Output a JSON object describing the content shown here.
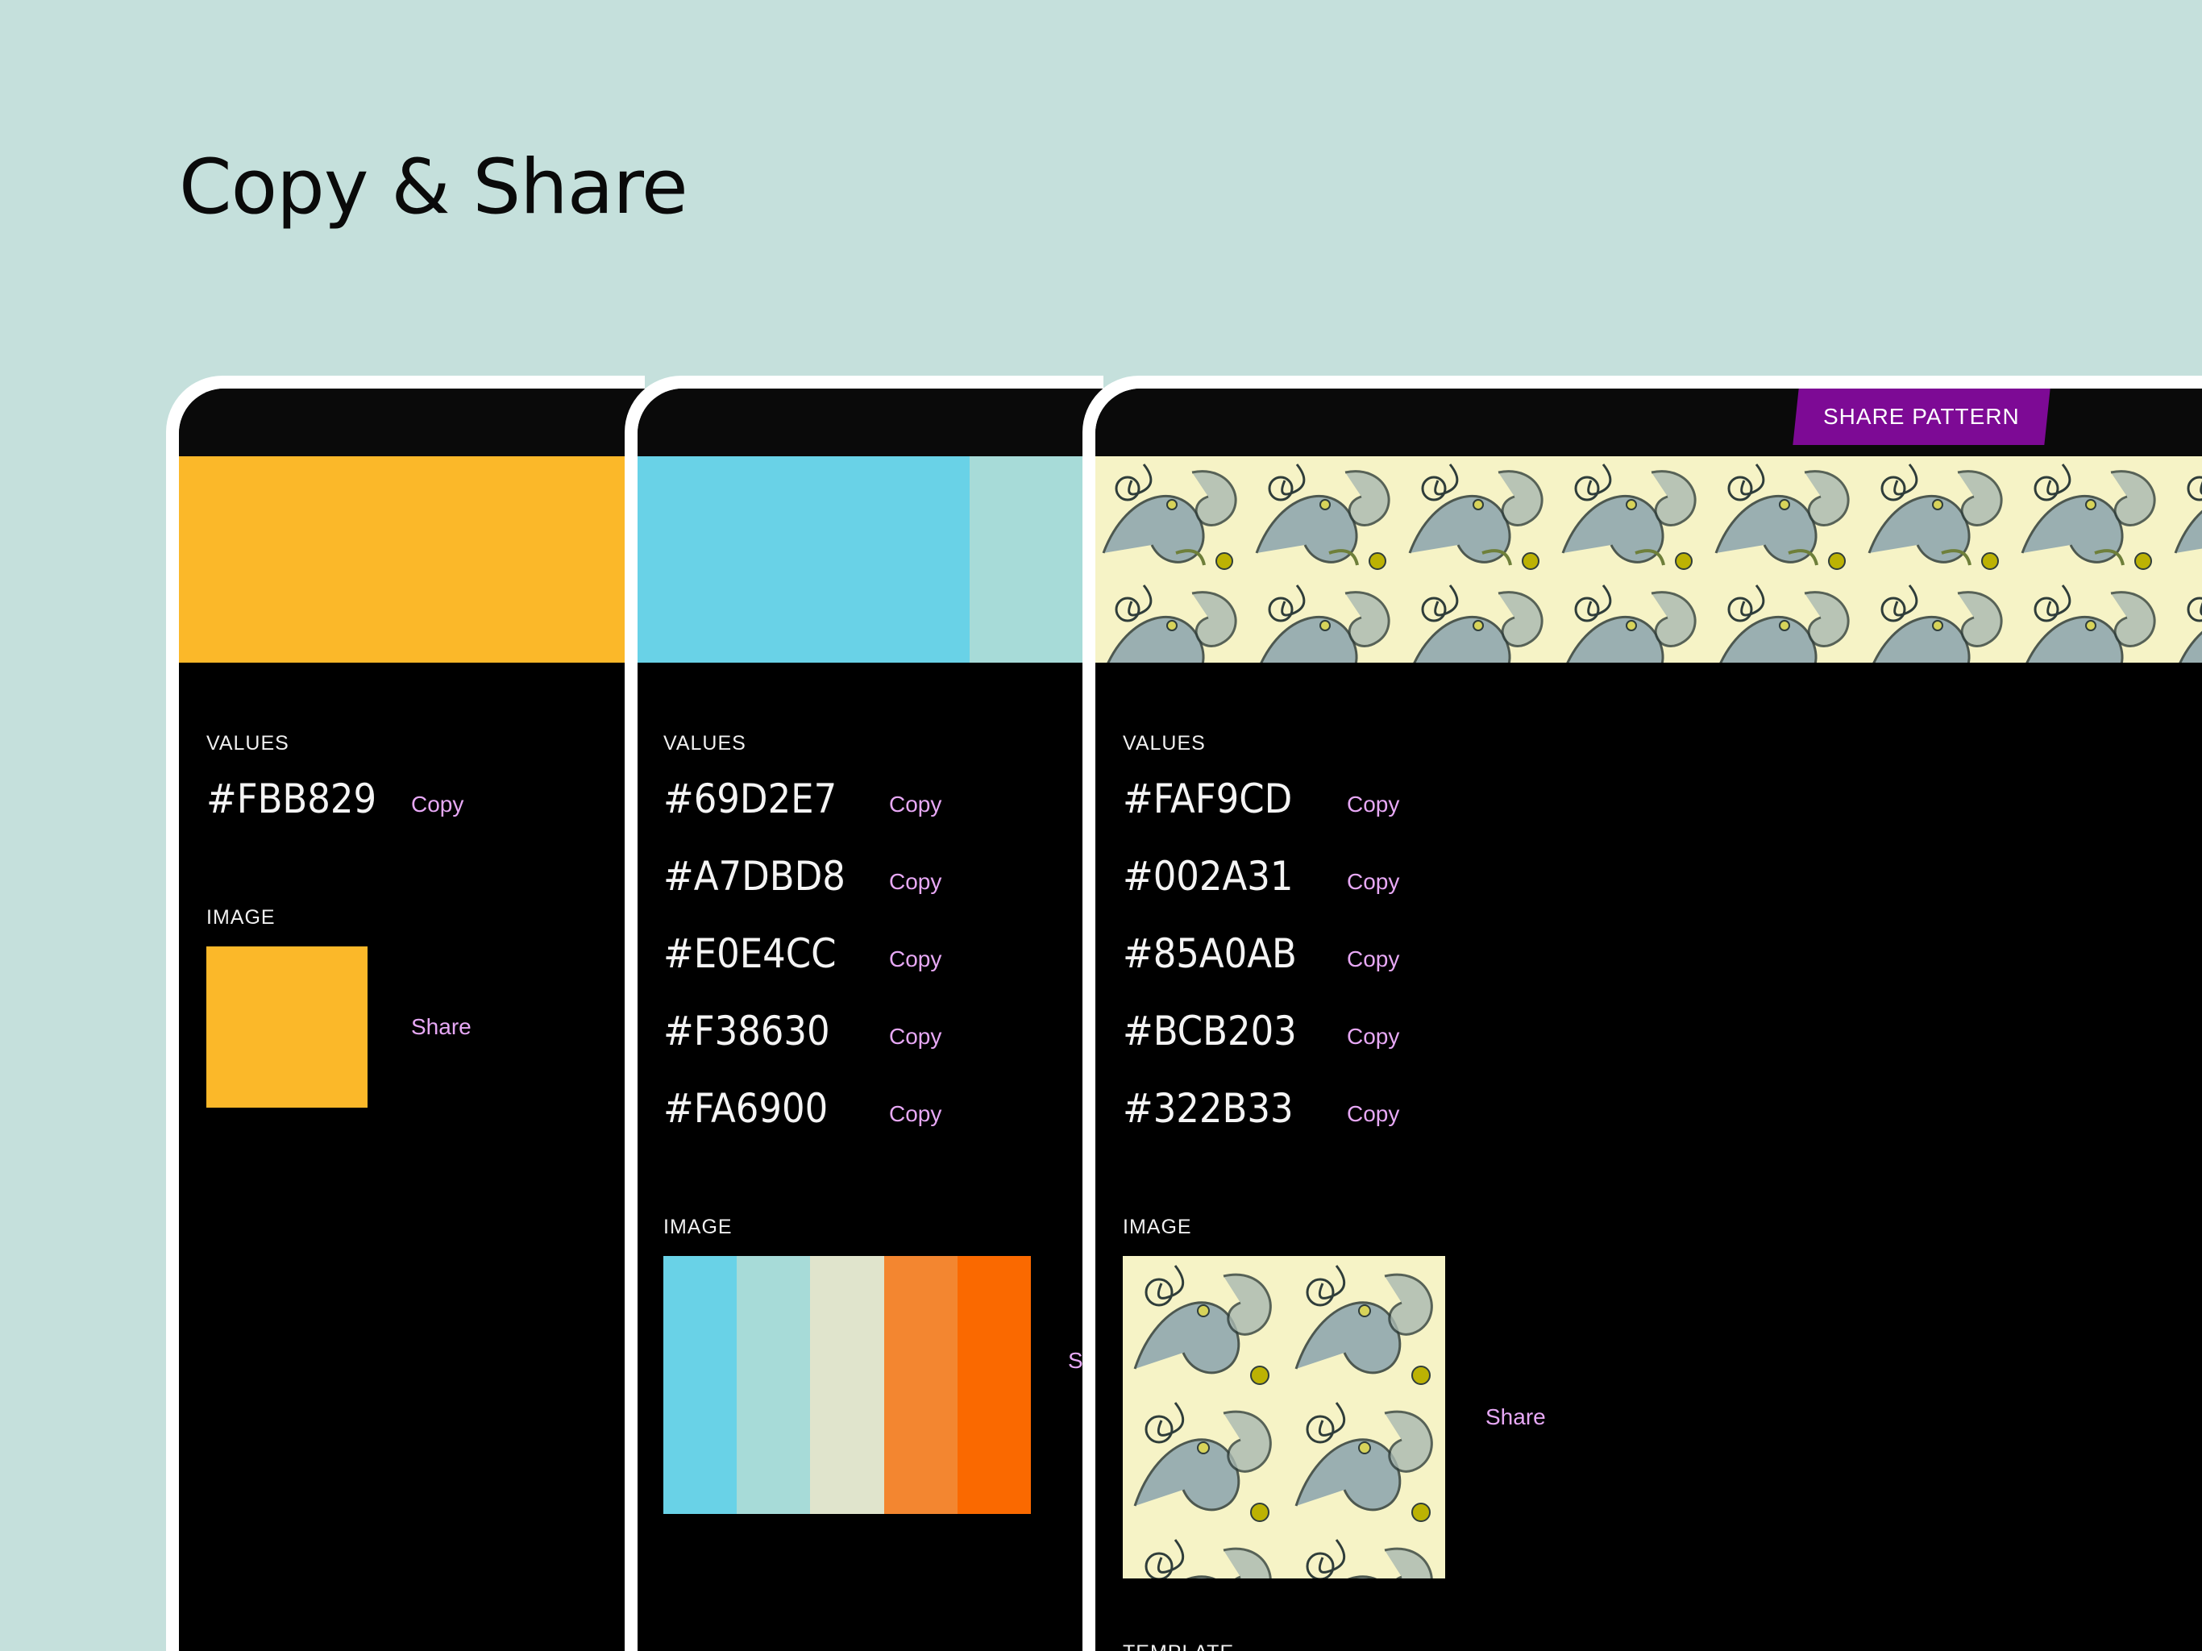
{
  "page": {
    "title": "Copy & Share"
  },
  "cards": [
    {
      "values_label": "VALUES",
      "values": [
        {
          "hex": "#FBB829",
          "copy": "Copy",
          "color": "#FBB829"
        }
      ],
      "image_label": "IMAGE",
      "image_colors": [
        "#FBB829"
      ],
      "share": "Share"
    },
    {
      "values_label": "VALUES",
      "values": [
        {
          "hex": "#69D2E7",
          "copy": "Copy",
          "color": "#69D2E7"
        },
        {
          "hex": "#A7DBD8",
          "copy": "Copy",
          "color": "#A7DBD8"
        },
        {
          "hex": "#E0E4CC",
          "copy": "Copy",
          "color": "#E0E4CC"
        },
        {
          "hex": "#F38630",
          "copy": "Copy",
          "color": "#F38630"
        },
        {
          "hex": "#FA6900",
          "copy": "Copy",
          "color": "#FA6900"
        }
      ],
      "image_label": "IMAGE",
      "share": "Share"
    },
    {
      "share_pattern": "SHARE PATTERN",
      "values_label": "VALUES",
      "values": [
        {
          "hex": "#FAF9CD",
          "copy": "Copy",
          "color": "#FAF9CD"
        },
        {
          "hex": "#002A31",
          "copy": "Copy",
          "color": "#002A31"
        },
        {
          "hex": "#85A0AB",
          "copy": "Copy",
          "color": "#85A0AB"
        },
        {
          "hex": "#BCB203",
          "copy": "Copy",
          "color": "#BCB203"
        },
        {
          "hex": "#322B33",
          "copy": "Copy",
          "color": "#322B33"
        }
      ],
      "image_label": "IMAGE",
      "share": "Share",
      "template_label": "TEMPLATE"
    }
  ],
  "colors": {
    "background": "#c5e0dc",
    "link": "#e7a8f5",
    "share_button": "#7d0a95"
  }
}
